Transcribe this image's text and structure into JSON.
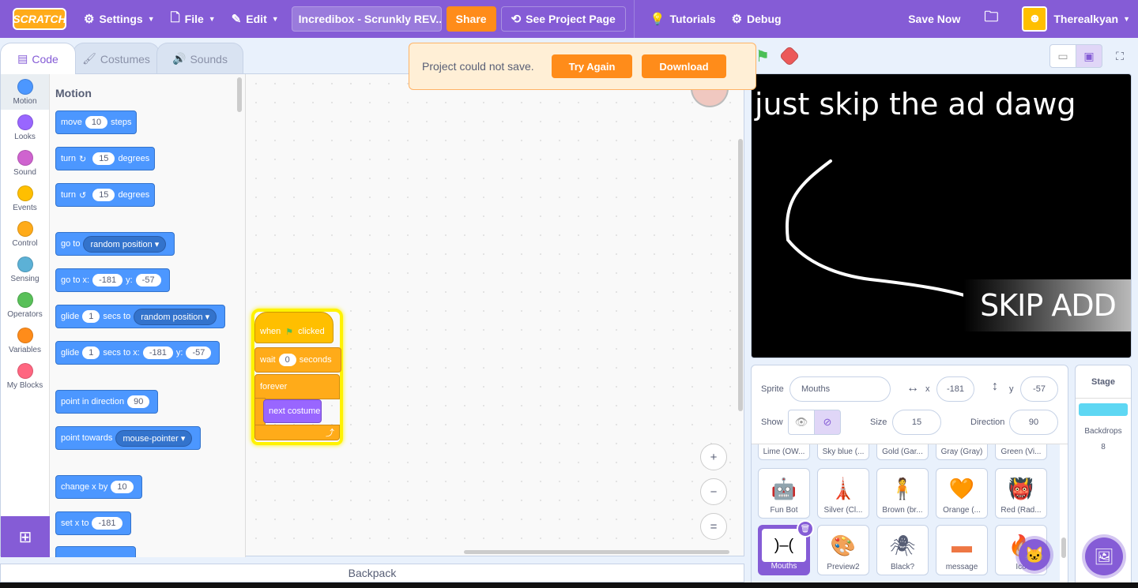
{
  "menubar": {
    "logo": "SCRATCH",
    "settings": "Settings",
    "file": "File",
    "edit": "Edit",
    "project_title": "Incredibox - Scrunkly REV...",
    "share": "Share",
    "see_project_page": "See Project Page",
    "tutorials": "Tutorials",
    "debug": "Debug",
    "save_now": "Save Now",
    "username": "Therealkyan"
  },
  "tabs": [
    {
      "label": "Code",
      "icon": "code-icon"
    },
    {
      "label": "Costumes",
      "icon": "brush-icon"
    },
    {
      "label": "Sounds",
      "icon": "speaker-icon"
    }
  ],
  "categories": [
    {
      "label": "Motion",
      "color": "#4c97ff"
    },
    {
      "label": "Looks",
      "color": "#9966ff"
    },
    {
      "label": "Sound",
      "color": "#cf63cf"
    },
    {
      "label": "Events",
      "color": "#ffbf00"
    },
    {
      "label": "Control",
      "color": "#ffab19"
    },
    {
      "label": "Sensing",
      "color": "#5cb1d6"
    },
    {
      "label": "Operators",
      "color": "#59c059"
    },
    {
      "label": "Variables",
      "color": "#ff8c1a"
    },
    {
      "label": "My Blocks",
      "color": "#ff6680"
    }
  ],
  "palette": {
    "title": "Motion",
    "move": {
      "pre": "move",
      "value": "10",
      "post": "steps"
    },
    "turn_right": {
      "pre": "turn",
      "value": "15",
      "post": "degrees"
    },
    "turn_left": {
      "pre": "turn",
      "value": "15",
      "post": "degrees"
    },
    "go_to": {
      "pre": "go to",
      "option": "random position"
    },
    "go_to_xy": {
      "pre": "go to x:",
      "x": "-181",
      "mid": "y:",
      "y": "-57"
    },
    "glide_to": {
      "pre": "glide",
      "value": "1",
      "mid": "secs to",
      "option": "random position"
    },
    "glide_xy": {
      "pre": "glide",
      "value": "1",
      "mid": "secs to x:",
      "x": "-181",
      "mid2": "y:",
      "y": "-57"
    },
    "point_dir": {
      "pre": "point in direction",
      "value": "90"
    },
    "point_towards": {
      "pre": "point towards",
      "option": "mouse-pointer"
    },
    "change_x": {
      "pre": "change x by",
      "value": "10"
    },
    "set_x": {
      "pre": "set x to",
      "value": "-181"
    }
  },
  "script": {
    "hat": {
      "pre": "when",
      "post": "clicked"
    },
    "wait": {
      "pre": "wait",
      "value": "0",
      "post": "seconds"
    },
    "forever": "forever",
    "next_costume": "next costume"
  },
  "zoom": {
    "in": "+",
    "out": "−",
    "reset": "="
  },
  "backpack": "Backpack",
  "alert": {
    "message": "Project could not save.",
    "try_again": "Try Again",
    "download": "Download"
  },
  "stage": {
    "text": "just skip the ad dawg",
    "overlay": "SKIP ADD"
  },
  "sprite_info": {
    "sprite_label": "Sprite",
    "sprite_name": "Mouths",
    "x_label": "x",
    "x": "-181",
    "y_label": "y",
    "y": "-57",
    "show_label": "Show",
    "size_label": "Size",
    "size": "15",
    "direction_label": "Direction",
    "direction": "90"
  },
  "sprites_row_top": [
    "Lime (OW...",
    "Sky blue (...",
    "Gold (Gar...",
    "Gray (Gray)",
    "Green (Vi..."
  ],
  "sprites_row1": [
    {
      "name": "Fun Bot",
      "thumb": "🤖"
    },
    {
      "name": "Silver (Cl...",
      "thumb": "🗼"
    },
    {
      "name": "Brown (br...",
      "thumb": "🧍"
    },
    {
      "name": "Orange (...",
      "thumb": "🧡"
    },
    {
      "name": "Red (Rad...",
      "thumb": "👹"
    }
  ],
  "sprites_row2": [
    {
      "name": "Mouths",
      "thumb": ")–("
    },
    {
      "name": "Preview2",
      "thumb": "🎨"
    },
    {
      "name": "Black?",
      "thumb": "🕷"
    },
    {
      "name": "message",
      "thumb": "▬"
    },
    {
      "name": "Ico",
      "thumb": "🔥"
    }
  ],
  "stage_pane": {
    "title": "Stage",
    "backdrops_label": "Backdrops",
    "backdrops_count": "8"
  }
}
